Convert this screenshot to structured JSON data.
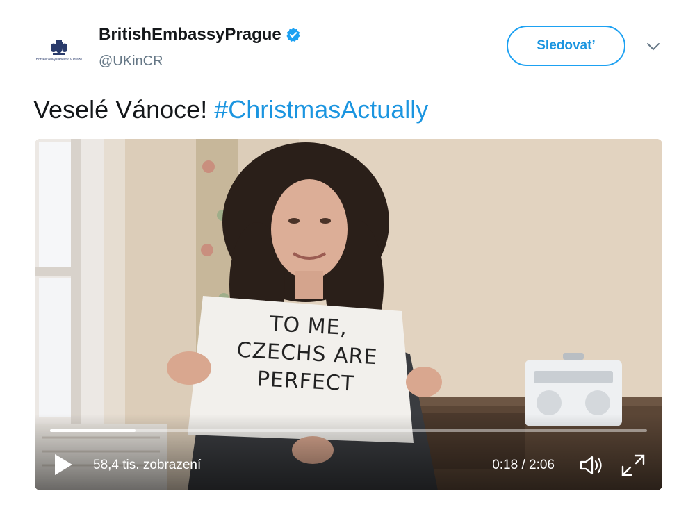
{
  "account": {
    "display_name": "BritishEmbassyPrague",
    "handle": "@UKinCR",
    "avatar_text": "Britské velvyslanectví v Praze",
    "verified": true
  },
  "actions": {
    "follow_label": "Sledovat’"
  },
  "tweet": {
    "text": "Veselé Vánoce! ",
    "hashtag": "#ChristmasActually"
  },
  "video": {
    "sign_text": [
      "TO ME,",
      "CZECHS ARE",
      "PERFECT"
    ],
    "views": "58,4 tis. zobrazení",
    "time": "0:18 / 2:06",
    "progress_fraction": 0.143
  },
  "colors": {
    "accent": "#1da1f2",
    "link": "#1b95e0",
    "muted": "#657786"
  },
  "icons": [
    "verified-badge-icon",
    "chevron-down-icon",
    "play-icon",
    "volume-icon",
    "fullscreen-icon",
    "crest-icon"
  ]
}
